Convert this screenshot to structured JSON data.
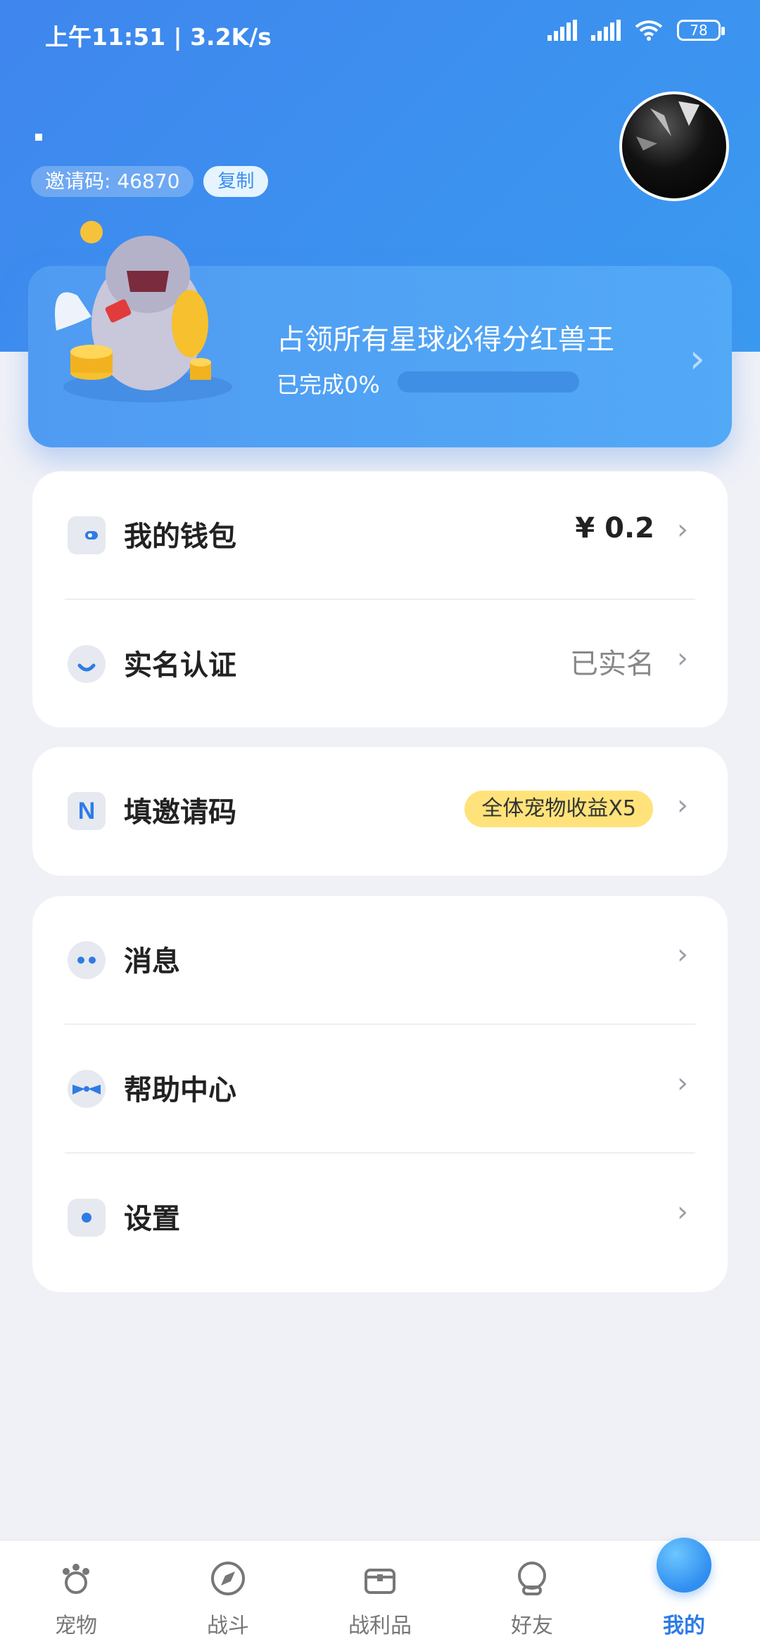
{
  "status_bar": {
    "time": "上午11:51 | 3.2K/s",
    "battery": "78"
  },
  "profile": {
    "invite_code_label": "邀请码: 46870",
    "copy_label": "复制"
  },
  "banner": {
    "title": "占领所有星球必得分红兽王",
    "progress_label": "已完成0%",
    "progress": 0
  },
  "menu": {
    "wallet": {
      "label": "我的钱包",
      "value": "¥ 0.2"
    },
    "realname": {
      "label": "实名认证",
      "value": "已实名"
    },
    "invite": {
      "label": "填邀请码",
      "badge": "全体宠物收益X5"
    },
    "messages": {
      "label": "消息"
    },
    "help": {
      "label": "帮助中心"
    },
    "settings": {
      "label": "设置"
    }
  },
  "tabbar": {
    "items": [
      {
        "label": "宠物"
      },
      {
        "label": "战斗"
      },
      {
        "label": "战利品"
      },
      {
        "label": "好友"
      },
      {
        "label": "我的"
      }
    ],
    "active_index": 4
  },
  "colors": {
    "primary": "#3f86ee",
    "accent": "#2e7be6",
    "badge": "#ffe37a",
    "background": "#f0f1f7"
  }
}
